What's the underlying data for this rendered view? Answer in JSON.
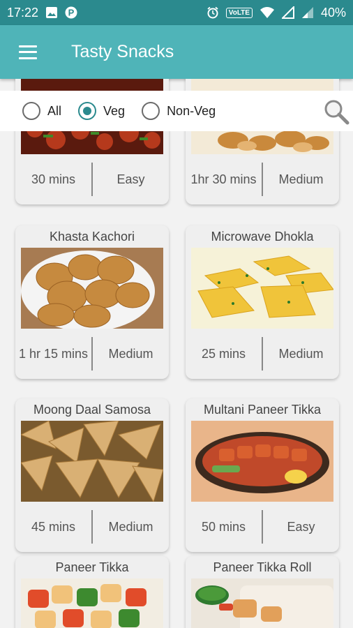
{
  "status": {
    "time": "17:22",
    "battery": "40%",
    "volte": "VoLTE"
  },
  "app": {
    "title": "Tasty Snacks"
  },
  "filters": [
    {
      "label": "All",
      "checked": false
    },
    {
      "label": "Veg",
      "checked": true
    },
    {
      "label": "Non-Veg",
      "checked": false
    }
  ],
  "recipes": [
    {
      "name": "",
      "time": "30 mins",
      "difficulty": "Easy"
    },
    {
      "name": "",
      "time": "1hr 30 mins",
      "difficulty": "Medium"
    },
    {
      "name": "Khasta Kachori",
      "time": "1 hr 15 mins",
      "difficulty": "Medium"
    },
    {
      "name": "Microwave Dhokla",
      "time": "25 mins",
      "difficulty": "Medium"
    },
    {
      "name": "Moong Daal Samosa",
      "time": "45 mins",
      "difficulty": "Medium"
    },
    {
      "name": "Multani Paneer Tikka",
      "time": "50 mins",
      "difficulty": "Easy"
    },
    {
      "name": "Paneer Tikka",
      "time": "",
      "difficulty": ""
    },
    {
      "name": "Paneer Tikka Roll",
      "time": "",
      "difficulty": ""
    }
  ],
  "colors": {
    "primary": "#4fb4b8",
    "primary_dark": "#2b8a8e",
    "card": "#efefef"
  }
}
